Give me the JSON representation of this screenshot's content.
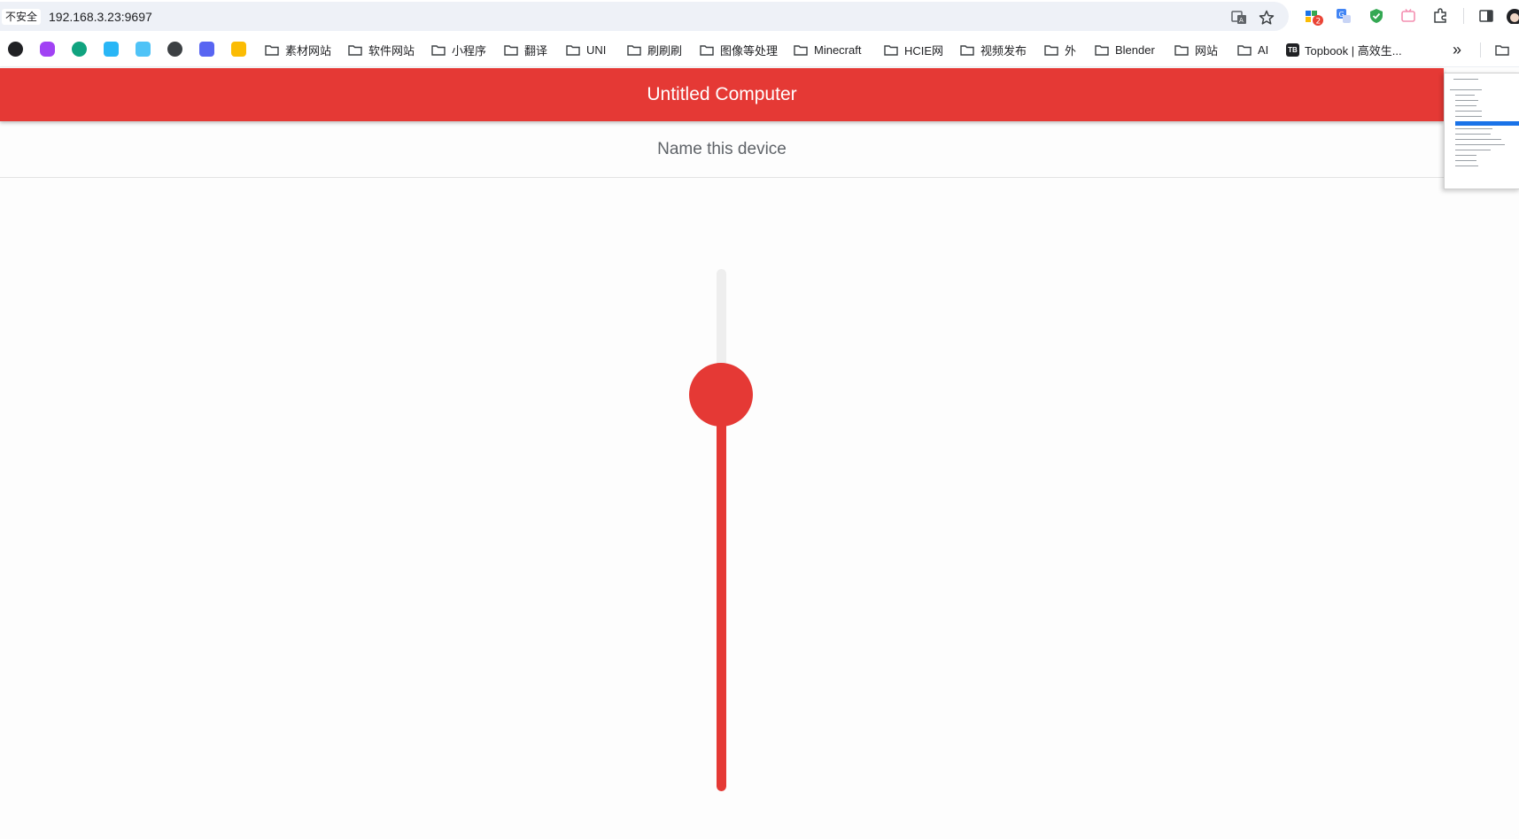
{
  "browser": {
    "insecure_label": "不安全",
    "url": "192.168.3.23:9697",
    "extension_badge": "2"
  },
  "bookmarks": {
    "folders": [
      "素材网站",
      "软件网站",
      "小程序",
      "翻译",
      "UNI",
      "刷刷刷",
      "图像等处理",
      "Minecraft",
      "HCIE网",
      "视频发布",
      "外",
      "Blender",
      "网站",
      "AI"
    ],
    "topbook": "Topbook | 高效生...",
    "more": "»"
  },
  "page": {
    "title": "Untitled Computer",
    "device_name_placeholder": "Name this device"
  },
  "slider": {
    "value_fraction": 0.76,
    "orientation": "vertical"
  },
  "colors": {
    "accent": "#e53935",
    "track": "#eeeeee"
  }
}
